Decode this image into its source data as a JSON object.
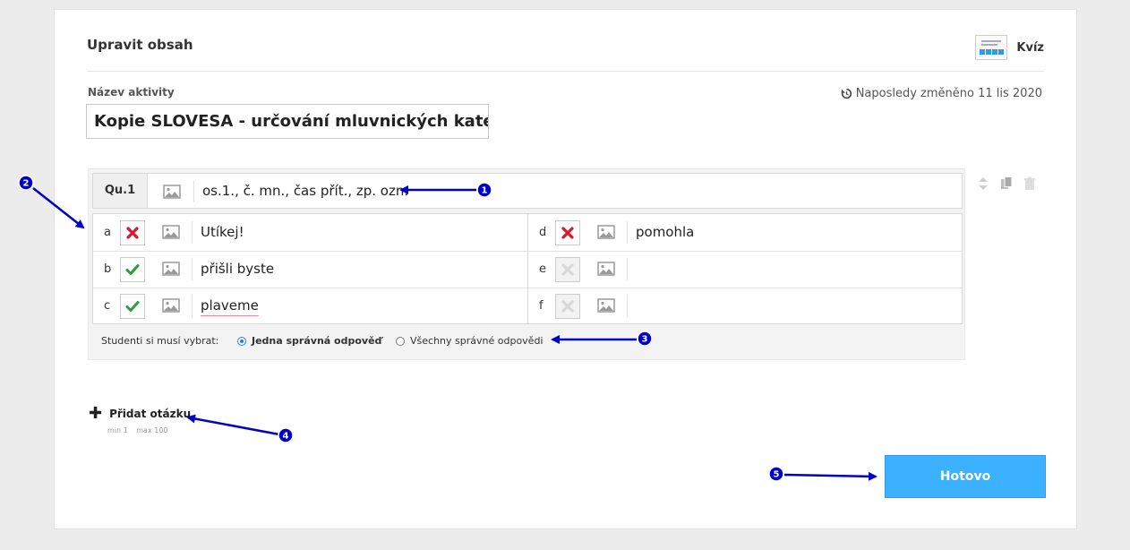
{
  "header": {
    "title": "Upravit obsah",
    "activity_type": "Kvíz"
  },
  "activity": {
    "name_label": "Název aktivity",
    "name_value": "Kopie SLOVESA - určování mluvnických kategorií",
    "last_modified": "Naposledy změněno 11 lis 2020"
  },
  "question": {
    "number": "Qu.1",
    "text": "os.1., č. mn., čas přít., zp. ozn.",
    "answers": [
      {
        "letter": "a",
        "text": "Utíkej!",
        "state": "wrong"
      },
      {
        "letter": "b",
        "text": "přišli byste",
        "state": "correct"
      },
      {
        "letter": "c",
        "text": "plaveme",
        "state": "correct"
      },
      {
        "letter": "d",
        "text": "pomohla",
        "state": "wrong"
      },
      {
        "letter": "e",
        "text": "",
        "state": "empty"
      },
      {
        "letter": "f",
        "text": "",
        "state": "empty"
      }
    ],
    "choice_label": "Studenti si musí vybrat:",
    "choice_options": [
      {
        "label": "Jedna správná odpověď",
        "selected": true
      },
      {
        "label": "Všechny správné odpovědi",
        "selected": false
      }
    ]
  },
  "add_question": {
    "label": "Přidat otázku",
    "min": "min 1",
    "max": "max 100"
  },
  "done_button": "Hotovo",
  "annotations": [
    "1",
    "2",
    "3",
    "4",
    "5"
  ],
  "colors": {
    "accent": "#3cb1ff",
    "wrong": "#d9182d",
    "correct": "#2e9b3c",
    "annotation": "#0000cc"
  }
}
